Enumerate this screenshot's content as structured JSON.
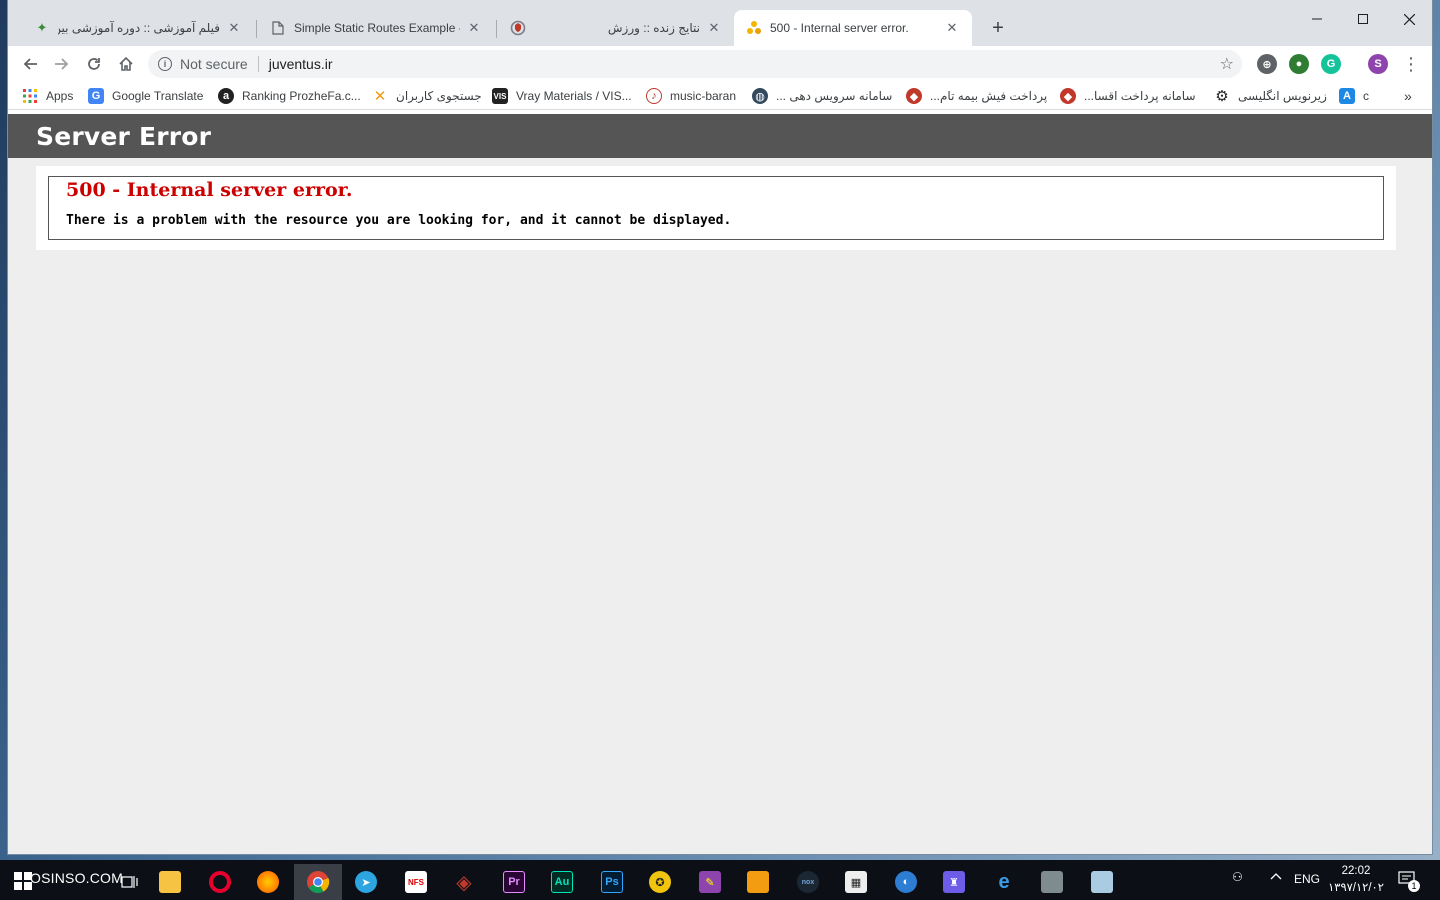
{
  "tabs": [
    {
      "title": "فیلم آموزشی :: دوره آموزشی بین الم",
      "favicon": "leaf-icon",
      "rtl": true
    },
    {
      "title": "Simple Static Routes Example - N",
      "favicon": "page-icon",
      "rtl": false
    },
    {
      "title": "",
      "favicon": "shield-icon",
      "rtl": false
    },
    {
      "title": "نتایج زنده :: ورزش سه",
      "favicon": "",
      "rtl": true
    },
    {
      "title": "500 - Internal server error.",
      "favicon": "warning-icon",
      "rtl": false,
      "active": true
    }
  ],
  "toolbar": {
    "security_label": "Not secure",
    "url": "juventus.ir"
  },
  "bookmarks": [
    {
      "label": "Apps",
      "icon": "apps-grid-icon"
    },
    {
      "label": "Google Translate",
      "icon": "translate-icon"
    },
    {
      "label": "Ranking ProzheFa.c...",
      "icon": "a-icon"
    },
    {
      "label": "جستجوی کاربران",
      "icon": "x-icon",
      "rtl": true
    },
    {
      "label": "Vray Materials / VIS...",
      "icon": "vis-icon"
    },
    {
      "label": "music-baran",
      "icon": "music-icon"
    },
    {
      "label": "سامانه سرویس دهی ...",
      "icon": "globe-icon",
      "rtl": true
    },
    {
      "label": "پرداخت فیش بیمه تام...",
      "icon": "insurance-icon",
      "rtl": true
    },
    {
      "label": "سامانه پرداخت اقسا...",
      "icon": "insurance-icon",
      "rtl": true
    },
    {
      "label": "زیرنویس انگلیسی",
      "icon": "gear-icon",
      "rtl": true
    },
    {
      "label": "c",
      "icon": "a-box-icon"
    }
  ],
  "page": {
    "header": "Server Error",
    "error_title": "500 - Internal server error.",
    "error_message": "There is a problem with the resource you are looking for, and it cannot be displayed."
  },
  "taskbar": {
    "brand": "OSINSO.COM",
    "language": "ENG",
    "time": "22:02",
    "date": "۱۳۹۷/۱۲/۰۲",
    "notification_count": "1"
  },
  "colors": {
    "header_bg": "#555555",
    "error_red": "#cc0000",
    "page_bg": "#eeeeee",
    "tabstrip_bg": "#dee1e6",
    "taskbar_bg": "#0c1016"
  }
}
